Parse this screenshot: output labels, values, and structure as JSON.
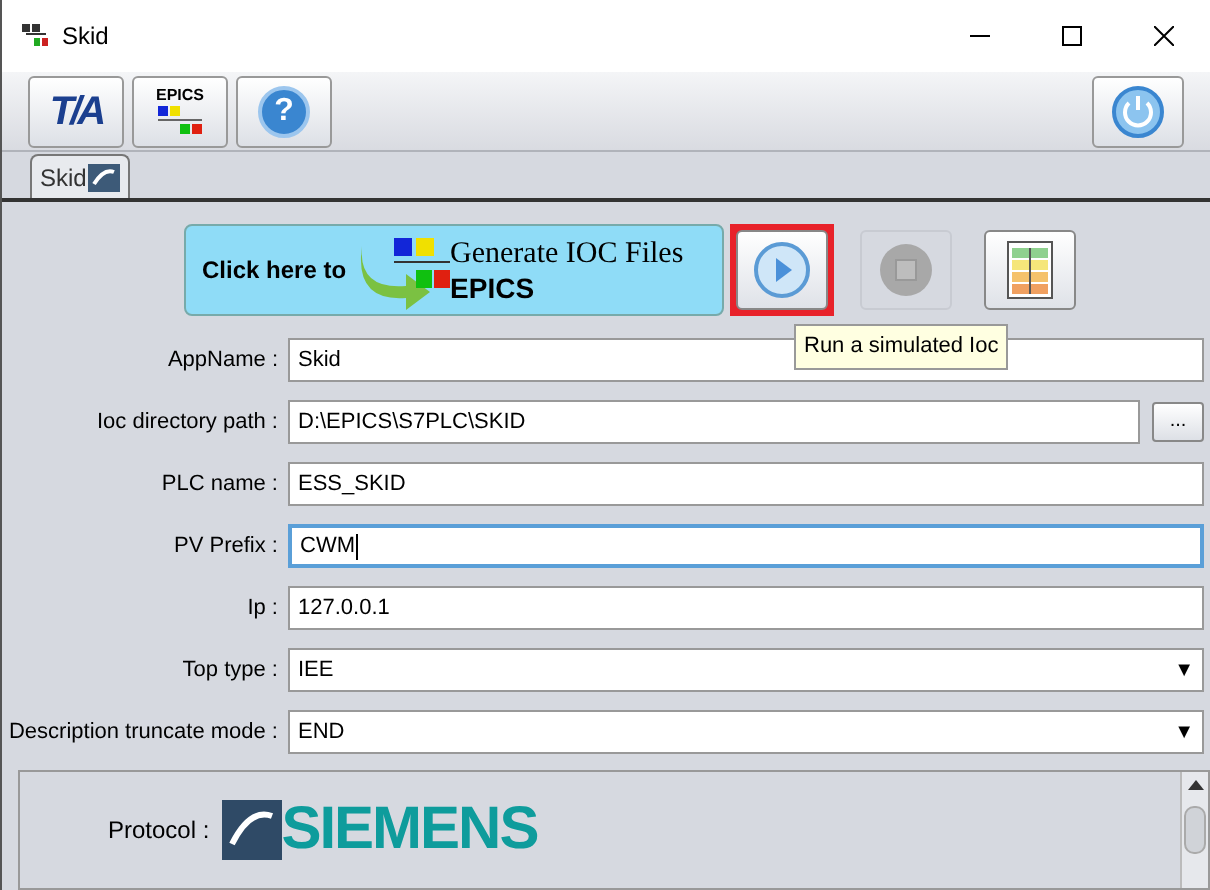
{
  "window": {
    "title": "Skid"
  },
  "toolbar": {
    "tia_logo": "T/A",
    "epics_logo": "EPICS",
    "help": "?"
  },
  "tabs": [
    {
      "label": "Skid",
      "selected": true
    }
  ],
  "generate_button": {
    "prefix": "Click here to",
    "title": "Generate IOC Files",
    "subtitle": "EPICS"
  },
  "actions": [
    {
      "kind": "play",
      "disabled": false,
      "highlighted": true
    },
    {
      "kind": "stop",
      "disabled": true,
      "highlighted": false
    },
    {
      "kind": "table",
      "disabled": false,
      "highlighted": false
    }
  ],
  "tooltip": "Run a simulated Ioc",
  "fields": [
    {
      "label": "AppName :",
      "value": "Skid",
      "kind": "text",
      "focused": false
    },
    {
      "label": "Ioc directory path :",
      "value": "D:\\EPICS\\S7PLC\\SKID",
      "kind": "browse",
      "button": "...",
      "focused": false
    },
    {
      "label": "PLC name :",
      "value": "ESS_SKID",
      "kind": "text",
      "focused": false
    },
    {
      "label": "PV Prefix :",
      "value": "CWM",
      "kind": "text",
      "focused": true
    },
    {
      "label": "Ip :",
      "value": "127.0.0.1",
      "kind": "text",
      "focused": false
    },
    {
      "label": "Top type :",
      "value": "IEE",
      "kind": "select",
      "arrow": "▼"
    },
    {
      "label": "Description truncate mode :",
      "value": "END",
      "kind": "select",
      "arrow": "▼"
    }
  ],
  "protocol": {
    "label": "Protocol :",
    "logo": "SIEMENS"
  }
}
